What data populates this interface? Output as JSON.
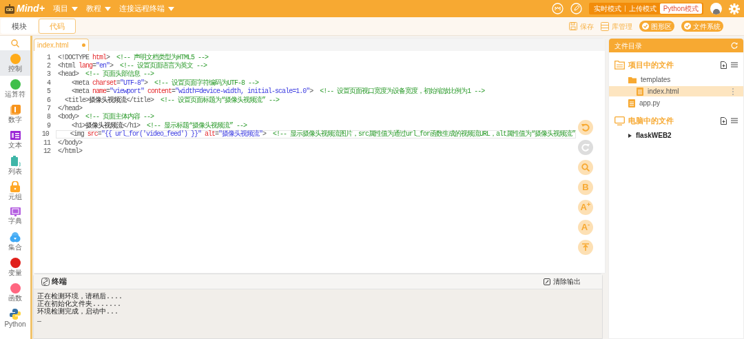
{
  "menu_bar": {
    "logo": "Mind+",
    "menus": [
      "项目",
      "教程",
      "连接远程终端"
    ]
  },
  "modes": [
    {
      "label": "实时模式",
      "selected": false
    },
    {
      "label": "上传模式",
      "selected": false
    },
    {
      "label": "Python模式",
      "selected": true
    }
  ],
  "view_tabs": [
    {
      "label": "模块",
      "selected": false
    },
    {
      "label": "代码",
      "selected": true
    }
  ],
  "toolbar": [
    {
      "label": "保存",
      "kind": "save"
    },
    {
      "label": "库管理",
      "kind": "library"
    },
    {
      "label": "图形区",
      "kind": "toggle"
    },
    {
      "label": "文件系统",
      "kind": "toggle"
    }
  ],
  "categories": [
    {
      "label": "控制",
      "kind": "circle",
      "color": "#ffab19",
      "selected": true
    },
    {
      "label": "运算符",
      "kind": "circle",
      "color": "#40bf4a",
      "selected": false
    },
    {
      "label": "数字",
      "kind": "number",
      "color": "#f7941d",
      "selected": false
    },
    {
      "label": "文本",
      "kind": "text",
      "color": "#9b27d6",
      "selected": false
    },
    {
      "label": "列表",
      "kind": "list",
      "color": "#3fb6a8",
      "selected": false
    },
    {
      "label": "元组",
      "kind": "lock",
      "color": "#ffa726",
      "selected": false
    },
    {
      "label": "字典",
      "kind": "dict",
      "color": "#b45ee0",
      "selected": false
    },
    {
      "label": "集合",
      "kind": "set",
      "color": "#3fa9f5",
      "selected": false
    },
    {
      "label": "变量",
      "kind": "circle",
      "color": "#e0201b",
      "selected": false
    },
    {
      "label": "函数",
      "kind": "circle",
      "color": "#ff6680",
      "selected": false
    },
    {
      "label": "Python",
      "kind": "python",
      "color": "#3572a5",
      "selected": false
    }
  ],
  "editor": {
    "file_tab": {
      "name": "index.html",
      "modified": true
    },
    "lines": [
      {
        "number": "1",
        "current": false,
        "tokens": [
          {
            "kind": "tag",
            "text": "<!DOCTYPE "
          },
          {
            "kind": "attr",
            "text": "html"
          },
          {
            "kind": "tag",
            "text": ">  "
          },
          {
            "kind": "comment",
            "text": "<!-- 声明文档类型为HTML5 -->"
          }
        ]
      },
      {
        "number": "2",
        "current": false,
        "tokens": [
          {
            "kind": "tag",
            "text": "<html "
          },
          {
            "kind": "attr",
            "text": "lang"
          },
          {
            "kind": "tag",
            "text": "="
          },
          {
            "kind": "value",
            "text": "\"en\""
          },
          {
            "kind": "tag",
            "text": ">  "
          },
          {
            "kind": "comment",
            "text": "<!-- 设置页面语言为英文 -->"
          }
        ]
      },
      {
        "number": "3",
        "current": false,
        "tokens": [
          {
            "kind": "tag",
            "text": "<head>  "
          },
          {
            "kind": "comment",
            "text": "<!-- 页面头部信息 -->"
          }
        ]
      },
      {
        "number": "4",
        "current": false,
        "tokens": [
          {
            "kind": "tag",
            "text": "    <meta "
          },
          {
            "kind": "attr",
            "text": "charset"
          },
          {
            "kind": "tag",
            "text": "="
          },
          {
            "kind": "value",
            "text": "\"UTF-8\""
          },
          {
            "kind": "tag",
            "text": ">  "
          },
          {
            "kind": "comment",
            "text": "<!-- 设置页面字符编码为UTF-8 -->"
          }
        ]
      },
      {
        "number": "5",
        "current": false,
        "tokens": [
          {
            "kind": "tag",
            "text": "    <meta "
          },
          {
            "kind": "attr",
            "text": "name"
          },
          {
            "kind": "tag",
            "text": "="
          },
          {
            "kind": "value",
            "text": "\"viewport\""
          },
          {
            "kind": "attr",
            "text": " content"
          },
          {
            "kind": "tag",
            "text": "="
          },
          {
            "kind": "value",
            "text": "\"width=device-width, initial-scale=1.0\""
          },
          {
            "kind": "tag",
            "text": ">  "
          },
          {
            "kind": "comment",
            "text": "<!-- 设置页面视口宽度为设备宽度，初始缩放比例为1 -->"
          }
        ]
      },
      {
        "number": "6",
        "current": false,
        "tokens": [
          {
            "kind": "tag",
            "text": "  <title>"
          },
          {
            "kind": "text",
            "text": "摄像头视频流"
          },
          {
            "kind": "tag",
            "text": "</title>  "
          },
          {
            "kind": "comment",
            "text": "<!-- 设置页面标题为“摄像头视频流” -->"
          }
        ]
      },
      {
        "number": "7",
        "current": false,
        "tokens": [
          {
            "kind": "tag",
            "text": "</head>"
          }
        ]
      },
      {
        "number": "8",
        "current": false,
        "tokens": [
          {
            "kind": "tag",
            "text": "<body>  "
          },
          {
            "kind": "comment",
            "text": "<!-- 页面主体内容 -->"
          }
        ]
      },
      {
        "number": "9",
        "current": false,
        "tokens": [
          {
            "kind": "tag",
            "text": "    <h1>"
          },
          {
            "kind": "text",
            "text": "摄像头视频流"
          },
          {
            "kind": "tag",
            "text": "</h1>  "
          },
          {
            "kind": "comment",
            "text": "<!-- 显示标题“摄像头视频流” -->"
          }
        ]
      },
      {
        "number": "10",
        "current": true,
        "tokens": [
          {
            "kind": "tag",
            "text": "    <img "
          },
          {
            "kind": "attr",
            "text": "src"
          },
          {
            "kind": "tag",
            "text": "="
          },
          {
            "kind": "value",
            "text": "\"{{ url_for('video_feed') }}\""
          },
          {
            "kind": "attr",
            "text": " alt"
          },
          {
            "kind": "tag",
            "text": "="
          },
          {
            "kind": "value",
            "text": "\"摄像头视频流\""
          },
          {
            "kind": "tag",
            "text": ">  "
          },
          {
            "kind": "comment",
            "text": "<!-- 显示摄像头视频流图片，src属性值为通过url_for函数生成的视频流URL，alt属性值为“摄像头视频流”"
          }
        ]
      },
      {
        "number": "11",
        "current": false,
        "tokens": [
          {
            "kind": "tag",
            "text": "</body>"
          }
        ]
      },
      {
        "number": "12",
        "current": false,
        "tokens": [
          {
            "kind": "tag",
            "text": "</html>"
          }
        ]
      }
    ],
    "tools": [
      {
        "kind": "undo",
        "disabled": false
      },
      {
        "kind": "redo",
        "disabled": true
      },
      {
        "kind": "search",
        "disabled": false
      },
      {
        "kind": "label",
        "label": "B",
        "disabled": false
      },
      {
        "kind": "label",
        "label": "A$^{+}$",
        "disabled": false
      },
      {
        "kind": "label",
        "label": "A$^{-}$",
        "disabled": false
      },
      {
        "kind": "collapse",
        "disabled": false
      }
    ]
  },
  "terminal": {
    "title": "终端",
    "clear_button": "清除输出",
    "lines": [
      "正在检测环境，请稍后....",
      "正在初始化文件夹.......",
      "环境检测完成，启动中...",
      "_"
    ]
  },
  "file_panel": {
    "title": "文件目录",
    "sections": [
      {
        "title": "项目中的文件",
        "kind": "project",
        "items": [
          {
            "name": "templates",
            "kind": "folder",
            "selected": false,
            "children": [
              {
                "name": "index.html",
                "kind": "file",
                "selected": true
              }
            ]
          },
          {
            "name": "app.py",
            "kind": "file",
            "selected": false
          }
        ]
      },
      {
        "title": "电脑中的文件",
        "kind": "computer",
        "items": [
          {
            "name": "flaskWEB2",
            "kind": "folder-collapsed",
            "selected": false
          }
        ]
      }
    ]
  }
}
